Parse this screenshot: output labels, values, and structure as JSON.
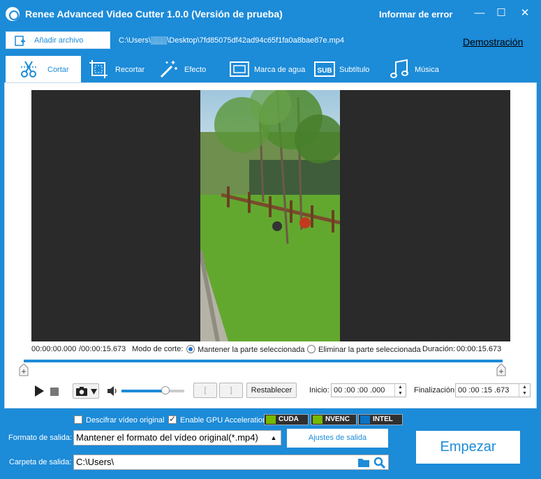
{
  "window": {
    "title": "Renee Advanced Video Cutter 1.0.0 (Versión de prueba)",
    "report_error": "Informar de error",
    "minimize": "—",
    "maximize": "☐",
    "close": "✕"
  },
  "file": {
    "add_label": "Añadir archivo",
    "path": "C:\\Users\\▒▒▒\\Desktop\\7fd85075df42ad94c65f1fa0a8bae87e.mp4",
    "demo_link": "Demostración"
  },
  "tabs": [
    {
      "label": "Cortar",
      "icon": "scissors-icon",
      "active": true
    },
    {
      "label": "Recortar",
      "icon": "crop-icon",
      "active": false
    },
    {
      "label": "Efecto",
      "icon": "magic-wand-icon",
      "active": false
    },
    {
      "label": "Marca de agua",
      "icon": "watermark-icon",
      "active": false
    },
    {
      "label": "Subtítulo",
      "icon": "subtitle-icon",
      "active": false
    },
    {
      "label": "Música",
      "icon": "music-icon",
      "active": false
    }
  ],
  "subtitle_icon_text": "SUB",
  "player": {
    "current_time": "00:00:00.000",
    "total_time": "/00:00:15.673",
    "cut_mode_label": "Modo de corte:",
    "mode_keep": "Mantener la parte seleccionada",
    "mode_remove": "Eliminar la parte seleccionada",
    "duration_label": "Duración:",
    "duration_value": "00:00:15.673",
    "volume_level": 0.7,
    "reset_label": "Restablecer",
    "start_label": "Inicio:",
    "start_value": "00 :00 :00 .000",
    "end_label": "Finalización:",
    "end_value": "00 :00 :15 .673",
    "bracket_left": "[",
    "bracket_right": "]"
  },
  "options": {
    "decrypt_label": "Descifrar vídeo original",
    "decrypt_checked": false,
    "gpu_label": "Enable GPU Acceleration",
    "gpu_checked": true,
    "badges": [
      "CUDA",
      "NVENC",
      "INTEL"
    ]
  },
  "output": {
    "format_label": "Formato de salida:",
    "format_value": "Mantener el formato del vídeo original(*.mp4)",
    "settings_button": "Ajustes de salida",
    "folder_label": "Carpeta de salida:",
    "folder_value": "C:\\Users\\",
    "start_button": "Empezar"
  },
  "colors": {
    "accent": "#1c8bd8",
    "video_bg": "#2a2a2a"
  }
}
